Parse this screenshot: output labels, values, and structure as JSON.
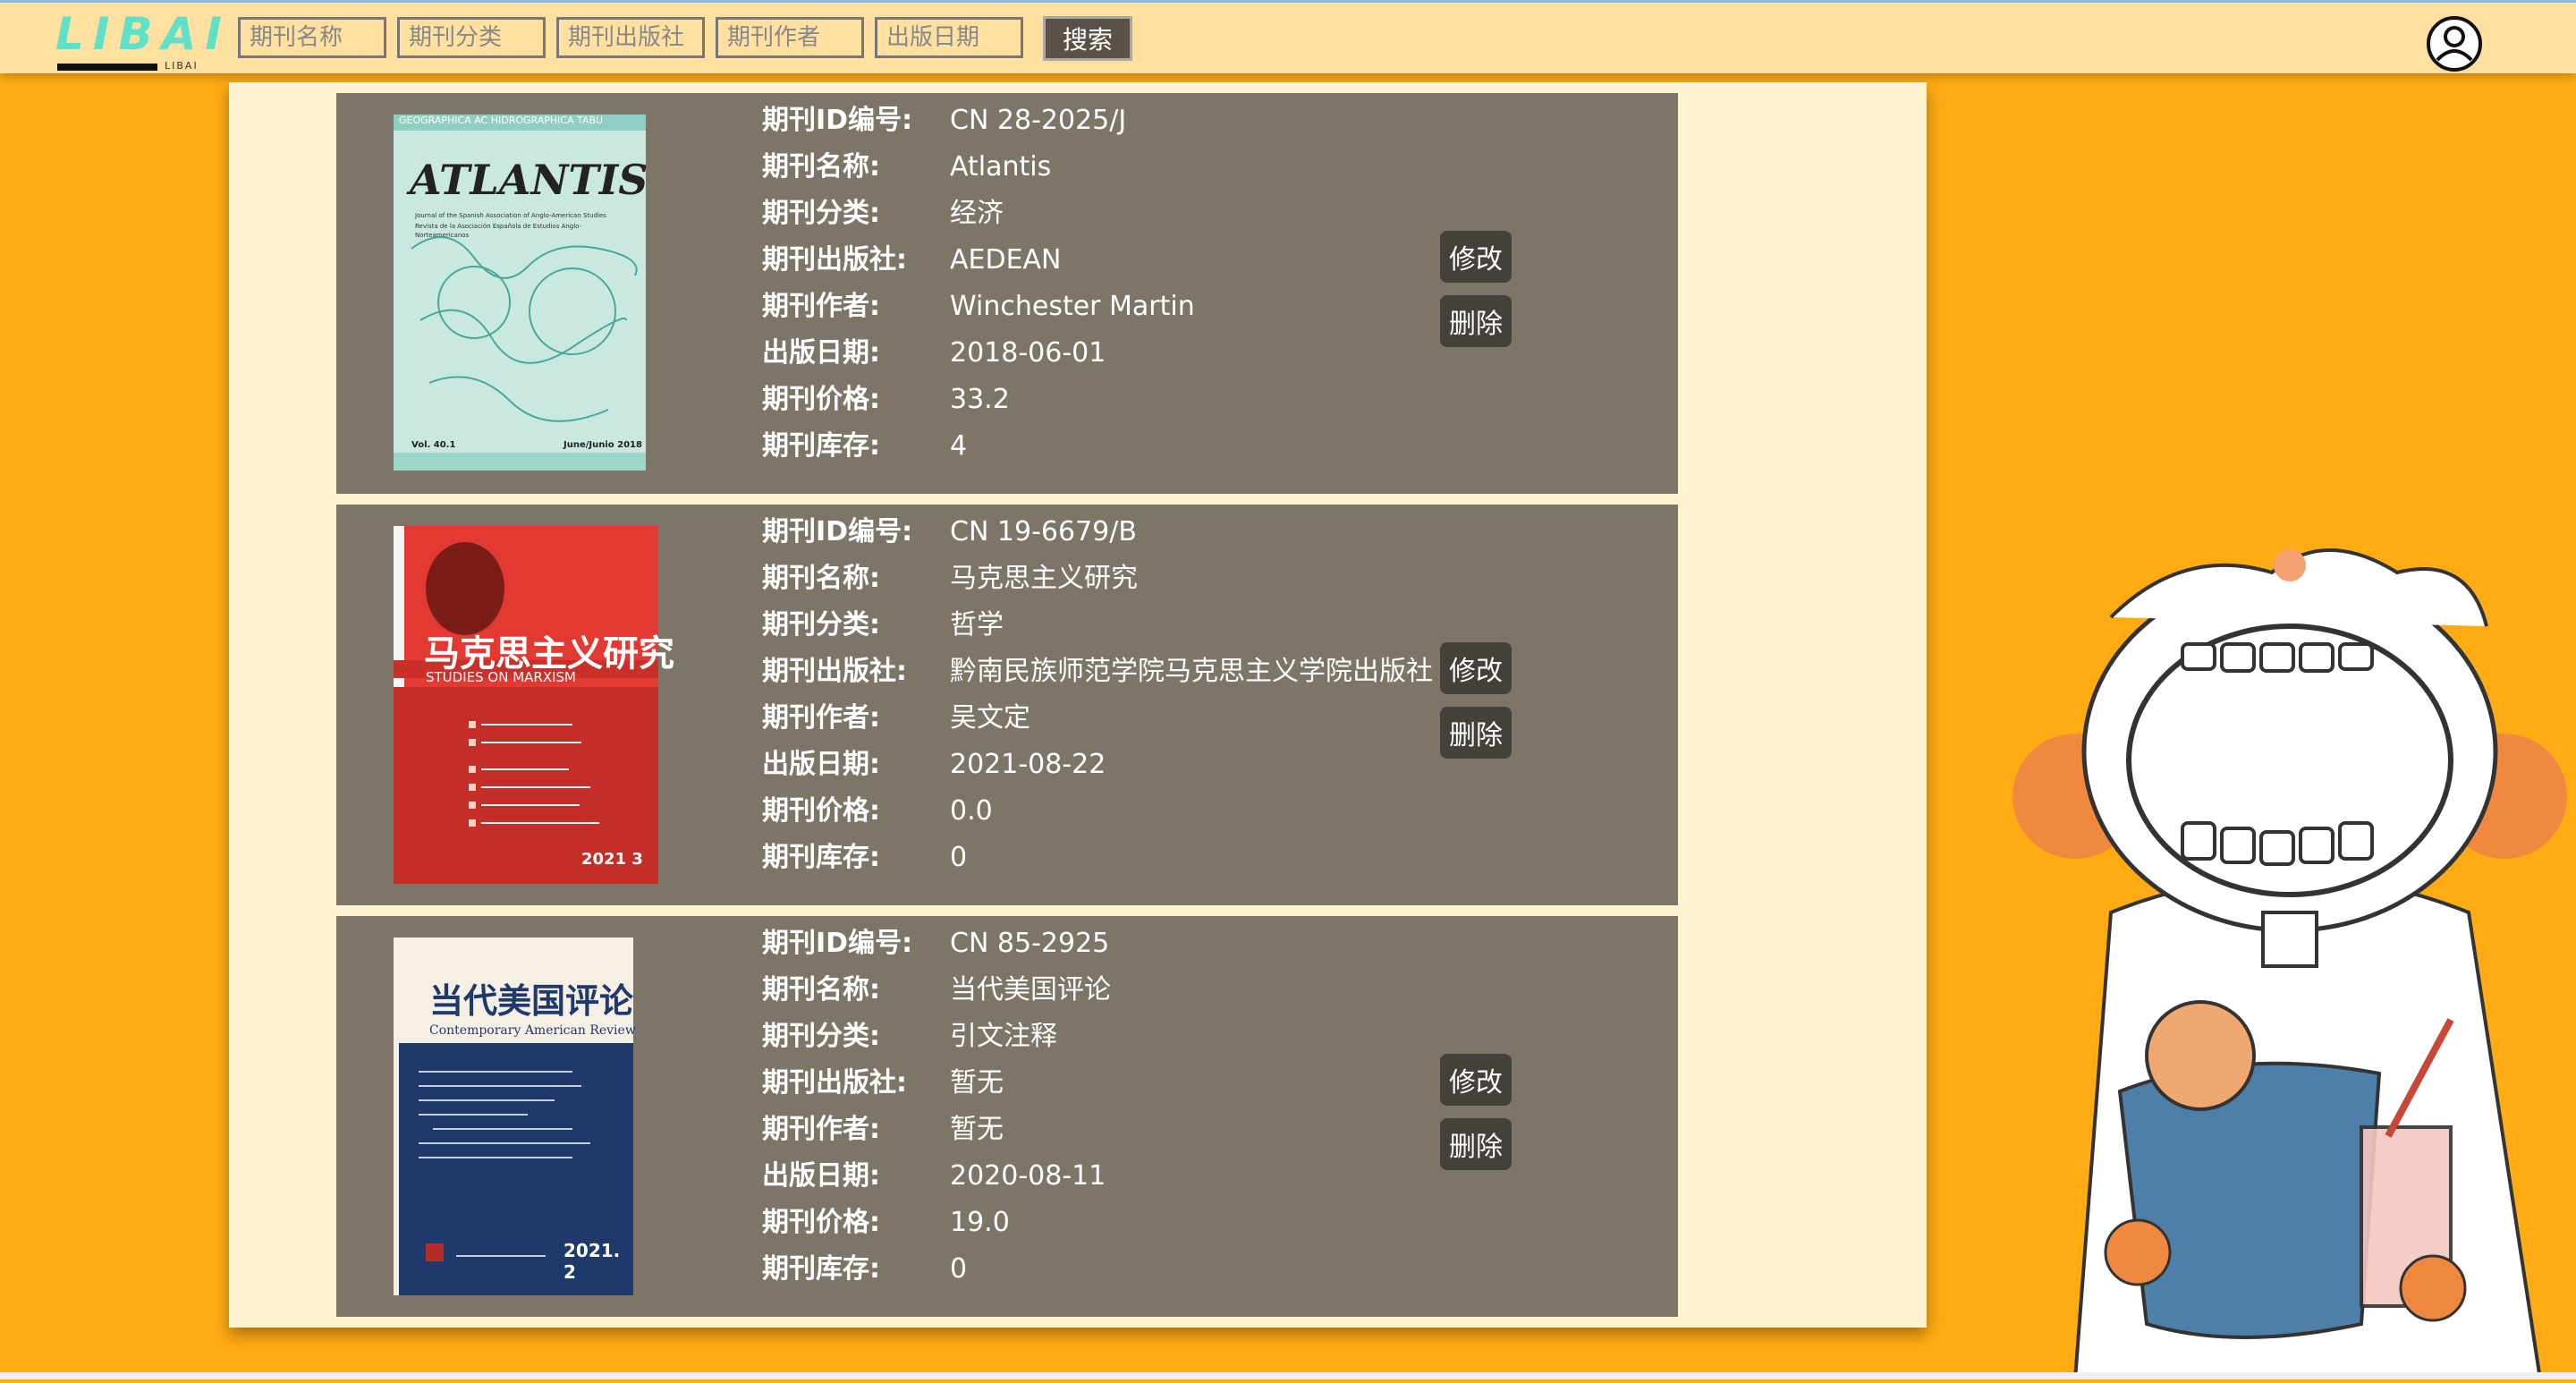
{
  "header": {
    "logo_text": "LIBAI",
    "logo_sub": "LIBAI",
    "search": {
      "name_placeholder": "期刊名称",
      "category_placeholder": "期刊分类",
      "publisher_placeholder": "期刊出版社",
      "author_placeholder": "期刊作者",
      "date_placeholder": "出版日期",
      "button_label": "搜索"
    },
    "avatar_icon": "user-circle-icon"
  },
  "labels": {
    "id": "期刊ID编号:",
    "name": "期刊名称:",
    "category": "期刊分类:",
    "publisher": "期刊出版社:",
    "author": "期刊作者:",
    "date": "出版日期:",
    "price": "期刊价格:",
    "stock": "期刊库存:",
    "edit": "修改",
    "delete": "删除"
  },
  "journals": [
    {
      "id": "CN 28-2025/J",
      "name": "Atlantis",
      "category": "经济",
      "publisher": "AEDEAN",
      "author": "Winchester Martin",
      "date": "2018-06-01",
      "price": "33.2",
      "stock": "4",
      "cover": {
        "title": "ATLANTIS",
        "top_text": "GEOGRAPHICA  AC  HIDROGRAPHICA  TABU",
        "subtitle1": "Journal of the Spanish Association of Anglo-American Studies",
        "subtitle2": "Revista de la Asociación Española de Estudios Anglo-Norteamericanos",
        "volume": "Vol. 40.1",
        "issue": "June/Junio 2018"
      }
    },
    {
      "id": "CN 19-6679/B",
      "name": "马克思主义研究",
      "category": "哲学",
      "publisher": "黔南民族师范学院马克思主义学院出版社",
      "author": "吴文定",
      "date": "2021-08-22",
      "price": "0.0",
      "stock": "0",
      "cover": {
        "title": "马克思主义研究",
        "subtitle": "STUDIES ON MARXISM",
        "issue": "2021 3"
      }
    },
    {
      "id": "CN 85-2925",
      "name": "当代美国评论",
      "category": "引文注释",
      "publisher": "暂无",
      "author": "暂无",
      "date": "2020-08-11",
      "price": "19.0",
      "stock": "0",
      "cover": {
        "title": "当代美国评论",
        "subtitle": "Contemporary American Review",
        "issue": "2021. 2"
      }
    }
  ],
  "colors": {
    "background": "#ffac14",
    "header": "#ffe0a0",
    "panel": "#fff2d0",
    "card": "#7d7668",
    "button": "#44403a"
  }
}
